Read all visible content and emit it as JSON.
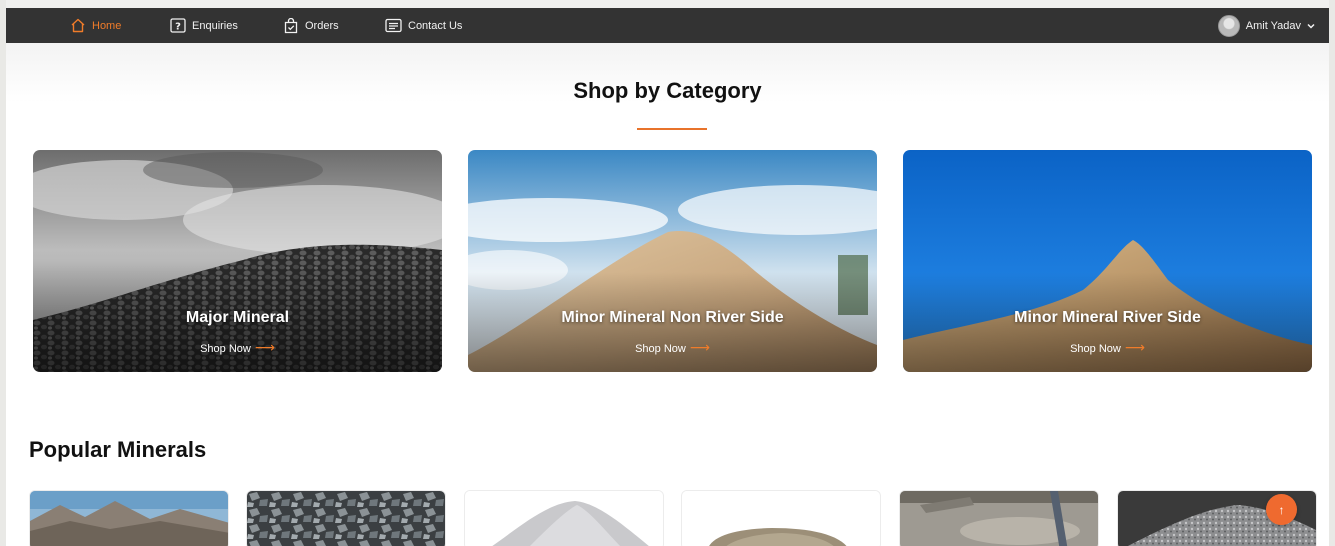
{
  "nav": {
    "items": [
      {
        "label": "Home",
        "icon": "home-icon",
        "active": true
      },
      {
        "label": "Enquiries",
        "icon": "question-icon",
        "active": false
      },
      {
        "label": "Orders",
        "icon": "shopping-bag-icon",
        "active": false
      },
      {
        "label": "Contact Us",
        "icon": "message-icon",
        "active": false
      }
    ],
    "user_name": "Amit Yadav",
    "accent": "#f07c2a"
  },
  "categories": {
    "title": "Shop by Category",
    "cards": [
      {
        "label": "Major Mineral",
        "cta": "Shop Now",
        "arrow": "⟶"
      },
      {
        "label": "Minor Mineral Non River Side",
        "cta": "Shop Now",
        "arrow": "⟶"
      },
      {
        "label": "Minor Mineral River Side",
        "cta": "Shop Now",
        "arrow": "⟶"
      }
    ]
  },
  "popular": {
    "title": "Popular Minerals"
  },
  "fab": {
    "icon": "arrow-up-icon",
    "glyph": "↑",
    "color": "#ef6a2f"
  }
}
